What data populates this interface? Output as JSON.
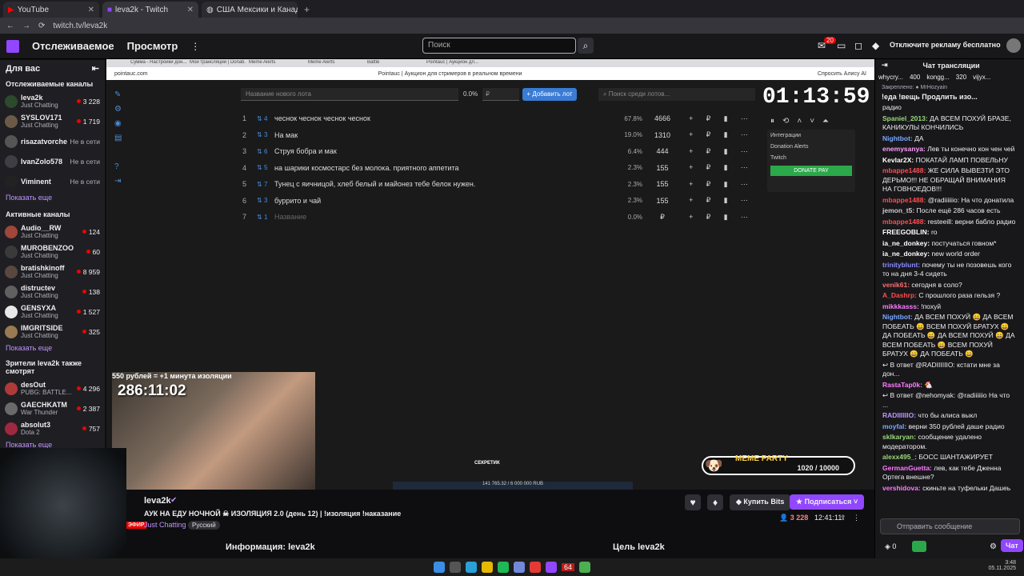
{
  "browser": {
    "tabs": [
      {
        "title": "YouTube"
      },
      {
        "title": "leva2k - Twitch"
      },
      {
        "title": "США Мексики и Канады - По..."
      }
    ],
    "url": "twitch.tv/leva2k"
  },
  "nav": {
    "following": "Отслеживаемое",
    "browse": "Просмотр",
    "search_placeholder": "Поиск",
    "notif_count": "20",
    "ad_free": "Отключите рекламу бесплатно"
  },
  "sidebar": {
    "for_you": "Для вас",
    "followed_header": "Отслеживаемые каналы",
    "followed": [
      {
        "name": "leva2k",
        "game": "Just Chatting",
        "viewers": "3 228",
        "color": "#2c4a2e"
      },
      {
        "name": "SYSLOV171",
        "game": "Just Chatting",
        "viewers": "1 719",
        "color": "#6c5a48"
      },
      {
        "name": "risazatvorche...",
        "game": "",
        "viewers": "Не в сети",
        "color": "#555"
      },
      {
        "name": "IvanZolo578",
        "game": "",
        "viewers": "Не в сети",
        "color": "#3e3e44"
      },
      {
        "name": "Viminent",
        "game": "",
        "viewers": "Не в сети",
        "color": "#222"
      }
    ],
    "show_more": "Показать еще",
    "active_header": "Активные каналы",
    "active": [
      {
        "name": "Audio__RW",
        "game": "Just Chatting",
        "viewers": "124",
        "color": "#a0463a"
      },
      {
        "name": "MUROBENZOO",
        "game": "Just Chatting",
        "viewers": "60",
        "color": "#3a3a3a"
      },
      {
        "name": "bratishkinoff",
        "game": "Just Chatting",
        "viewers": "8 959",
        "color": "#5a4840"
      },
      {
        "name": "distructev",
        "game": "Just Chatting",
        "viewers": "138",
        "color": "#606060"
      },
      {
        "name": "GENSYXA",
        "game": "Just Chatting",
        "viewers": "1 527",
        "color": "#e8e8e8"
      },
      {
        "name": "IMGRITSIDE",
        "game": "Just Chatting",
        "viewers": "325",
        "color": "#9a7a52"
      }
    ],
    "also_watch_header": "Зрители leva2k также смотрят",
    "also": [
      {
        "name": "desOut",
        "game": "PUBG: BATTLE...",
        "viewers": "4 296",
        "color": "#b03a3a"
      },
      {
        "name": "GAECHKATM",
        "game": "War Thunder",
        "viewers": "2 387",
        "color": "#6a6a6a"
      },
      {
        "name": "absolut3",
        "game": "Dota 2",
        "viewers": "757",
        "color": "#a02840"
      }
    ]
  },
  "inner": {
    "url": "pointauc.com",
    "page_title": "Pointauc | Аукцион для стримеров в реальном времени",
    "tabs": [
      "Сумма - Настройки дон...",
      "Мои трансляции | Donati...",
      "Meme Alerts",
      "Meme Alerts",
      "Battle",
      "Pointauc | Аукцион дл..."
    ],
    "alice": "Спросить Алису AI"
  },
  "auction": {
    "new_lot_placeholder": "Название нового лота",
    "percent": "0.0%",
    "currency": "₽",
    "add_button": "Добавить лот",
    "search_placeholder": "Поиск среди лотов...",
    "timer": "01:13:59",
    "lots": [
      {
        "n": "1",
        "id": "4",
        "name": "чеснок чеснок чеснок чеснок",
        "pct": "67.8%",
        "amount": "4666"
      },
      {
        "n": "2",
        "id": "3",
        "name": "На мак",
        "pct": "19.0%",
        "amount": "1310"
      },
      {
        "n": "3",
        "id": "6",
        "name": "Струя бобра и мак",
        "pct": "6.4%",
        "amount": "444"
      },
      {
        "n": "4",
        "id": "5",
        "name": "на шарики космостарс без молока. приятного аппетита",
        "pct": "2.3%",
        "amount": "155"
      },
      {
        "n": "5",
        "id": "7",
        "name": "Тунец с яичницой, хлеб белый и майонез тебе белок нужен.",
        "pct": "2.3%",
        "amount": "155"
      },
      {
        "n": "6",
        "id": "3",
        "name": "буррито и чай",
        "pct": "2.3%",
        "amount": "155"
      },
      {
        "n": "7",
        "id": "1",
        "name": "Название",
        "pct": "0.0%",
        "amount": "₽"
      }
    ],
    "integrations": "Интеграции",
    "donation_alerts": "Donation Alerts",
    "twitch": "Twitch",
    "donate_pay": "DONATE PAY"
  },
  "overlay": {
    "isolation_rate": "550 рублей = +1 минута изоляции",
    "isolation_timer": "286:11:02",
    "meme_party": "MEME PARTY",
    "meme_progress": "1020 / 10000",
    "secret": "СЕКРЕТИК",
    "rub": "141 765.32 / 6 000 000 RUB"
  },
  "stream": {
    "channel": "leva2k",
    "title": "АУК НА ЕДУ НОЧНОЙ ☠ ИЗОЛЯЦИЯ 2.0 (день 12) | !изоляция !наказание",
    "category": "Just Chatting",
    "language": "Русский",
    "live": "ЭФИР",
    "viewers": "3 228",
    "uptime": "12:41:11",
    "bits_button": "Купить Bits",
    "follow_button": "Подписаться",
    "about": "Информация: leva2k",
    "goal": "Цель leva2k"
  },
  "chat": {
    "header": "Чат трансляции",
    "gift_bar": [
      {
        "user": "whycry...",
        "n": "400"
      },
      {
        "user": "kongg...",
        "n": "320"
      },
      {
        "user": "vijyx...",
        "n": ""
      }
    ],
    "pinned": "Закреплено: ● MrHozyain",
    "pinned_text": "!еда !вещь Продлить изо...",
    "messages": [
      {
        "u": "",
        "c": "#efeff1",
        "t": "радио"
      },
      {
        "u": "Spaniel_2013:",
        "c": "#9ad87a",
        "t": "ДА ВСЕМ ПОХУЙ БРАЗЕ, КАНИКУЛЫ КОНЧИЛИСЬ"
      },
      {
        "u": "Nightbot:",
        "c": "#7aa8ff",
        "t": "ДА"
      },
      {
        "u": "enemysanya:",
        "c": "#ff9cff",
        "t": "Лев ты конечно кон чен чей"
      },
      {
        "u": "Kevlar2X:",
        "c": "#fff",
        "t": "ПОКАТАЙ ЛАМП ПОВЕЛЬНУ"
      },
      {
        "u": "mbappe1488:",
        "c": "#ff4d4d",
        "t": "ЖЕ СИЛА ВЫВЕЗТИ ЭТО ДЕРЬМО!!! НЕ ОБРАЩАЙ ВНИМАНИЯ НА ГОВНОЕДОВ!!!"
      },
      {
        "u": "mbappe1488:",
        "c": "#ff4d4d",
        "t": "@radiiiiiio: На что донатила"
      },
      {
        "u": "jemon_t5:",
        "c": "#ccc",
        "t": "После ещё 286 часов есть"
      },
      {
        "u": "mbappe1488:",
        "c": "#ff4d4d",
        "t": "resteeill: верни бабло радио"
      },
      {
        "u": "FREEGOBLIN:",
        "c": "#fff",
        "t": "ro"
      },
      {
        "u": "ia_ne_donkey:",
        "c": "#fff",
        "t": "постучаться говном*"
      },
      {
        "u": "ia_ne_donkey:",
        "c": "#fff",
        "t": "new world order"
      },
      {
        "u": "trinityblunt:",
        "c": "#8a8aff",
        "t": "почему ты не позовешь кого то на дня 3-4 сидеть"
      },
      {
        "u": "venik61:",
        "c": "#ff6e6e",
        "t": "сегодня в соло?"
      },
      {
        "u": "A_Dashrp:",
        "c": "#ff4d4d",
        "t": "С прошлого раза гельзя ?"
      },
      {
        "u": "mikkkasss:",
        "c": "#ff7aff",
        "t": "!похуй"
      },
      {
        "u": "Nightbot:",
        "c": "#7aa8ff",
        "t": "ДА ВСЕМ ПОХУЙ 😄 ДА ВСЕМ ПОБЕАТЬ 😄 ВСЕМ ПОХУЙ БРАТУХ 😄 ДА ПОБЕАТЬ 😄 ДА ВСЕМ ПОХУЙ 😄 ДА ВСЕМ ПОБЕАТЬ 😄 ВСЕМ ПОХУЙ БРАТУХ 😄 ДА ПОБЕАТЬ 😄"
      },
      {
        "u": "",
        "c": "#adadb8",
        "t": "↩ В ответ @RADIIIIIIO: кстати мне за дон..."
      },
      {
        "u": "RastaTap0k:",
        "c": "#ff7aff",
        "t": "🐔"
      },
      {
        "u": "",
        "c": "#adadb8",
        "t": "↩ В ответ @nehomyak: @radiiiiiio На что ..."
      },
      {
        "u": "RADIIIIIIO:",
        "c": "#bf94ff",
        "t": "что бы алиса выкл"
      },
      {
        "u": "moyfal:",
        "c": "#7aa8ff",
        "t": "верни 350 рублей даше радио"
      },
      {
        "u": "sklkaryan:",
        "c": "#9ad87a",
        "t": "сообщение удалено модератором."
      },
      {
        "u": "alexx495_:",
        "c": "#9ad87a",
        "t": "БОСС ШАНТАЖИРУЕТ"
      },
      {
        "u": "GermanGuetta:",
        "c": "#ff7aff",
        "t": "лев, как тебе Дженна Ортега внешне?"
      },
      {
        "u": "vershidova:",
        "c": "#ff7aff",
        "t": "скиньте на туфельки Дашеь"
      }
    ],
    "input_placeholder": "Отправить сообщение",
    "points": "0",
    "chat_button": "Чат"
  },
  "taskbar": {
    "clock": "3:48",
    "date": "05.11.2025",
    "badge": "64"
  }
}
